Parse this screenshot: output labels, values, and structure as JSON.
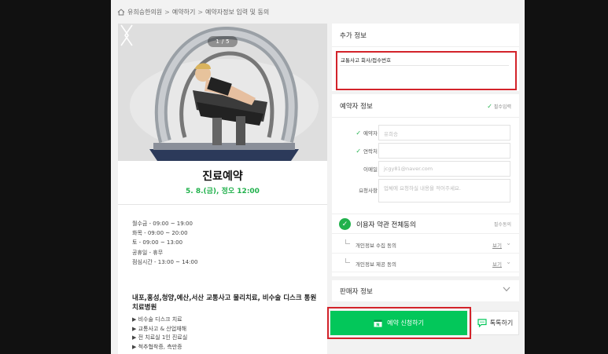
{
  "breadcrumb": [
    "유희승한의원",
    "예약하기",
    "예약자정보 입력 및 동의"
  ],
  "hero": {
    "pager_current": "1",
    "pager_total": "5"
  },
  "product": {
    "title": "진료예약",
    "date": "5. 8.(금), 정오 12:00",
    "hours": [
      "월수금 - 09:00 ~ 19:00",
      "화목 - 09:00 ~ 20:00",
      "토 - 09:00 ~ 13:00",
      "공휴일 - 휴무",
      "점심시간 - 13:00 ~ 14:00"
    ],
    "desc_title": "내포,홍성,청양,예산,서산 교통사고 물리치료, 비수술 디스크 통원치료병원",
    "features": [
      "▶ 비수술 디스크 치료",
      "▶ 교통사고 & 산업재해",
      "▶ 전 치료실 1인 진료실",
      "▶ 척추협착증, 측만증"
    ]
  },
  "extra": {
    "header": "추가 정보",
    "field_label": "교통사고 회사/접수번호",
    "field_value": ""
  },
  "booker": {
    "header": "예약자 정보",
    "required": "필수입력",
    "name_label": "예약자",
    "name_value": "유희승",
    "phone_label": "연락처",
    "phone_value": "",
    "email_label": "이메일",
    "email_value": "jcgy81@naver.com",
    "request_label": "요청사항",
    "request_placeholder": "업체에 요청하실 내용을 적어주세요."
  },
  "agreement": {
    "all_label": "이용자 약관 전체동의",
    "all_tag": "필수동의",
    "items": [
      {
        "label": "개인정보 수집 동의",
        "view": "보기"
      },
      {
        "label": "개인정보 제공 동의",
        "view": "보기"
      }
    ]
  },
  "seller": {
    "header": "판매자 정보"
  },
  "actions": {
    "submit": "예약 신청하기",
    "talk": "톡톡하기"
  },
  "colors": {
    "accent_green": "#03c75a",
    "highlight_red": "#d3232a",
    "date_green": "#21b14c"
  },
  "icons": [
    "home-icon",
    "chevron-left-icon",
    "chevron-right-icon",
    "check-icon",
    "chevron-down-icon",
    "calendar-icon",
    "talk-icon"
  ]
}
